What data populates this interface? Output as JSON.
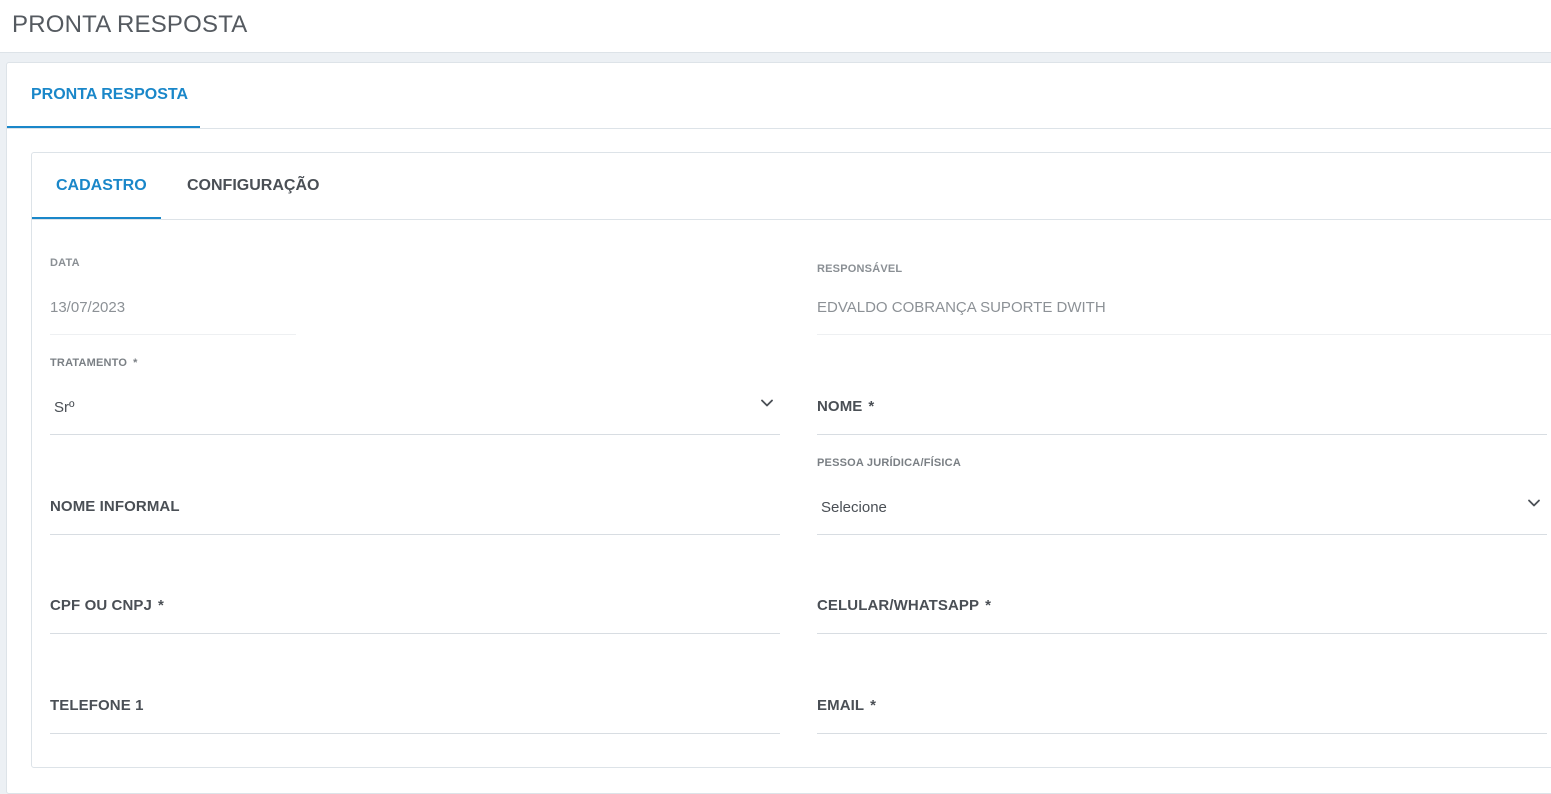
{
  "header": {
    "title": "PRONTA RESPOSTA"
  },
  "outer_tabs": [
    {
      "label": "PRONTA RESPOSTA",
      "active": true
    }
  ],
  "inner_tabs": [
    {
      "label": "CADASTRO",
      "active": true
    },
    {
      "label": "CONFIGURAÇÃO",
      "active": false
    }
  ],
  "form": {
    "data": {
      "label": "DATA",
      "value": "13/07/2023"
    },
    "responsavel": {
      "label": "RESPONSÁVEL",
      "value": "EDVALDO COBRANÇA SUPORTE DWITH"
    },
    "tratamento": {
      "label": "TRATAMENTO",
      "required": "*",
      "value": "Srº"
    },
    "nome": {
      "label": "NOME",
      "required": "*"
    },
    "pessoa": {
      "label": "PESSOA JURÍDICA/FÍSICA",
      "value": "Selecione"
    },
    "nome_informal": {
      "label": "NOME INFORMAL"
    },
    "cpf_cnpj": {
      "label": "CPF OU CNPJ",
      "required": "*"
    },
    "celular": {
      "label": "CELULAR/WHATSAPP",
      "required": "*"
    },
    "telefone1": {
      "label": "TELEFONE 1"
    },
    "email": {
      "label": "EMAIL",
      "required": "*"
    }
  },
  "colors": {
    "accent": "#1a87c9",
    "text": "#4a4f55",
    "muted": "#8c9196"
  },
  "icons": {
    "select_toggle": "chevron-down-icon"
  }
}
